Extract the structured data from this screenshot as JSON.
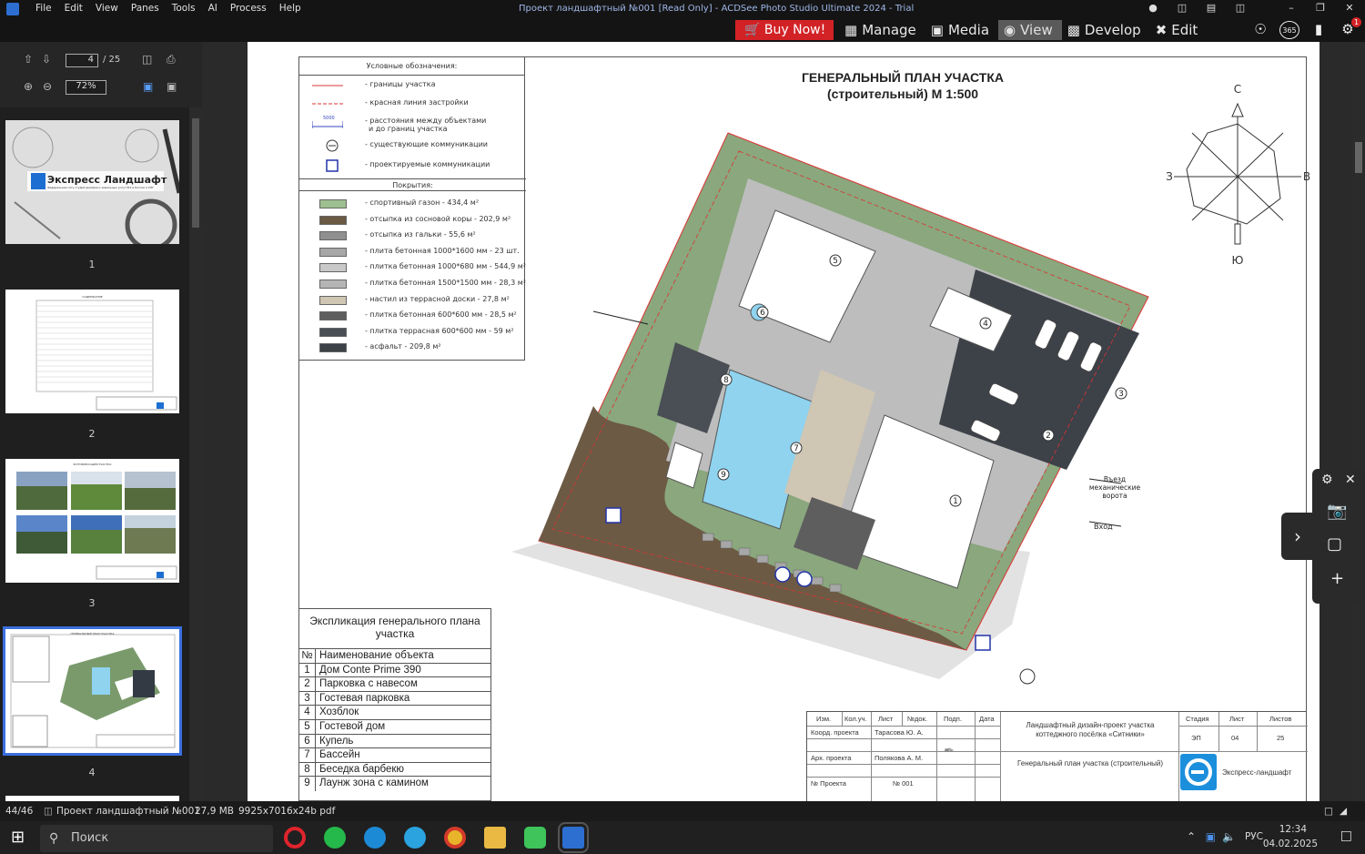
{
  "app": {
    "window_title": "Проект ландшафтный №001 [Read Only] - ACDSee Photo Studio Ultimate 2024 - Trial",
    "menu": [
      "File",
      "Edit",
      "View",
      "Panes",
      "Tools",
      "AI",
      "Process",
      "Help"
    ],
    "buy_now": "Buy Now!",
    "modes": [
      {
        "label": "Manage",
        "icon": "grid-icon"
      },
      {
        "label": "Media",
        "icon": "media-icon"
      },
      {
        "label": "View",
        "icon": "eye-icon",
        "active": true
      },
      {
        "label": "Develop",
        "icon": "develop-icon"
      },
      {
        "label": "Edit",
        "icon": "edit-icon"
      }
    ],
    "badge_count": "1",
    "badge_365": "365"
  },
  "nav": {
    "page_current": "4",
    "page_total": "/ 25",
    "zoom": "72%"
  },
  "thumbnails": {
    "items": [
      {
        "num": "1",
        "caption": "Экспресс Ландшафт",
        "subcaption": "Федеральная сеть студий дизайна и земельных услуг №1 в России и СНГ"
      },
      {
        "num": "2",
        "caption": "СОДЕРЖАНИЕ"
      },
      {
        "num": "3",
        "caption": "ФОТОФИКСАЦИЯ УЧАСТКА"
      },
      {
        "num": "4",
        "caption": "ГЕНЕРАЛЬНЫЙ ПЛАН УЧАСТКА"
      }
    ]
  },
  "document": {
    "title_line1": "ГЕНЕРАЛЬНЫЙ ПЛАН УЧАСТКА",
    "title_line2": "(строительный) М 1:500",
    "legend": {
      "header": "Условные обозначения:",
      "items": [
        "- границы участка",
        "- красная линия застройки",
        "- расстояния между объектами",
        "и до границ участка",
        "- существующие коммуникации",
        "- проектируемые коммуникации"
      ],
      "dim_label": "5000",
      "coverage_header": "Покрытия:",
      "coverage": [
        {
          "text": "- спортивный газон - 434,4 м²",
          "color": "#9ebf8f"
        },
        {
          "text": "- отсыпка из сосновой коры - 202,9 м²",
          "color": "#6b5a44"
        },
        {
          "text": "- отсыпка из гальки - 55,6 м²",
          "color": "#8f8f8f"
        },
        {
          "text": "- плита бетонная 1000*1600 мм - 23 шт.",
          "color": "#a7a7a7"
        },
        {
          "text": "- плитка бетонная 1000*680 мм - 544,9 м²",
          "color": "#c9c9c9"
        },
        {
          "text": "- плитка бетонная 1500*1500 мм - 28,3 м²",
          "color": "#b5b5b5"
        },
        {
          "text": "- настил из террасной доски - 27,8 м²",
          "color": "#cfc6b3"
        },
        {
          "text": "- плитка бетонная 600*600 мм - 28,5 м²",
          "color": "#5e5e5e"
        },
        {
          "text": "- плитка террасная 600*600 мм - 59 м²",
          "color": "#4a4e55"
        },
        {
          "text": "- асфальт - 209,8 м²",
          "color": "#3d4148"
        }
      ]
    },
    "explication": {
      "title": "Экспликация генерального плана участка",
      "col_num": "№",
      "col_name": "Наименование объекта",
      "rows": [
        {
          "n": "1",
          "t": "Дом Conte Prime 390"
        },
        {
          "n": "2",
          "t": "Парковка с навесом"
        },
        {
          "n": "3",
          "t": "Гостевая парковка"
        },
        {
          "n": "4",
          "t": "Хозблок"
        },
        {
          "n": "5",
          "t": "Гостевой дом"
        },
        {
          "n": "6",
          "t": "Купель"
        },
        {
          "n": "7",
          "t": "Бассейн"
        },
        {
          "n": "8",
          "t": "Беседка барбекю"
        },
        {
          "n": "9",
          "t": "Лаунж зона с камином"
        }
      ]
    },
    "compass": {
      "n": "С",
      "s": "Ю",
      "w": "З",
      "e": "В"
    },
    "plan_labels": {
      "entry_car": "Въезд механические ворота",
      "entry": "Вход",
      "numbers": [
        "1",
        "2",
        "3",
        "4",
        "5",
        "6",
        "7",
        "8",
        "9"
      ]
    },
    "stamp": {
      "h_izm": "Изм.",
      "h_kol": "Кол.уч.",
      "h_list": "Лист",
      "h_ndok": "№док.",
      "h_podp": "Подп.",
      "h_data": "Дата",
      "role1": "Коорд. проекта",
      "name1": "Тарасова Ю. А.",
      "role2": "Арх. проекта",
      "name2": "Полякова А. М.",
      "role3": "№ Проекта",
      "proj_no": "№ 001",
      "project": "Ландшафтный дизайн-проект участка коттеджного посёлка «Ситники»",
      "sheet_title": "Генеральный план участка (строительный)",
      "h_stage": "Стадия",
      "h_sheet": "Лист",
      "h_sheets": "Листов",
      "stage": "ЭП",
      "sheet": "04",
      "sheets": "25",
      "org": "Экспресс-ландшафт"
    }
  },
  "status": {
    "index": "44/46",
    "filename": "Проект ландшафтный №001",
    "size": "27,9 MB",
    "dims": "9925x7016x24b pdf"
  },
  "taskbar": {
    "search": "Поиск",
    "lang": "РУС",
    "time": "12:34",
    "date": "04.02.2025"
  }
}
